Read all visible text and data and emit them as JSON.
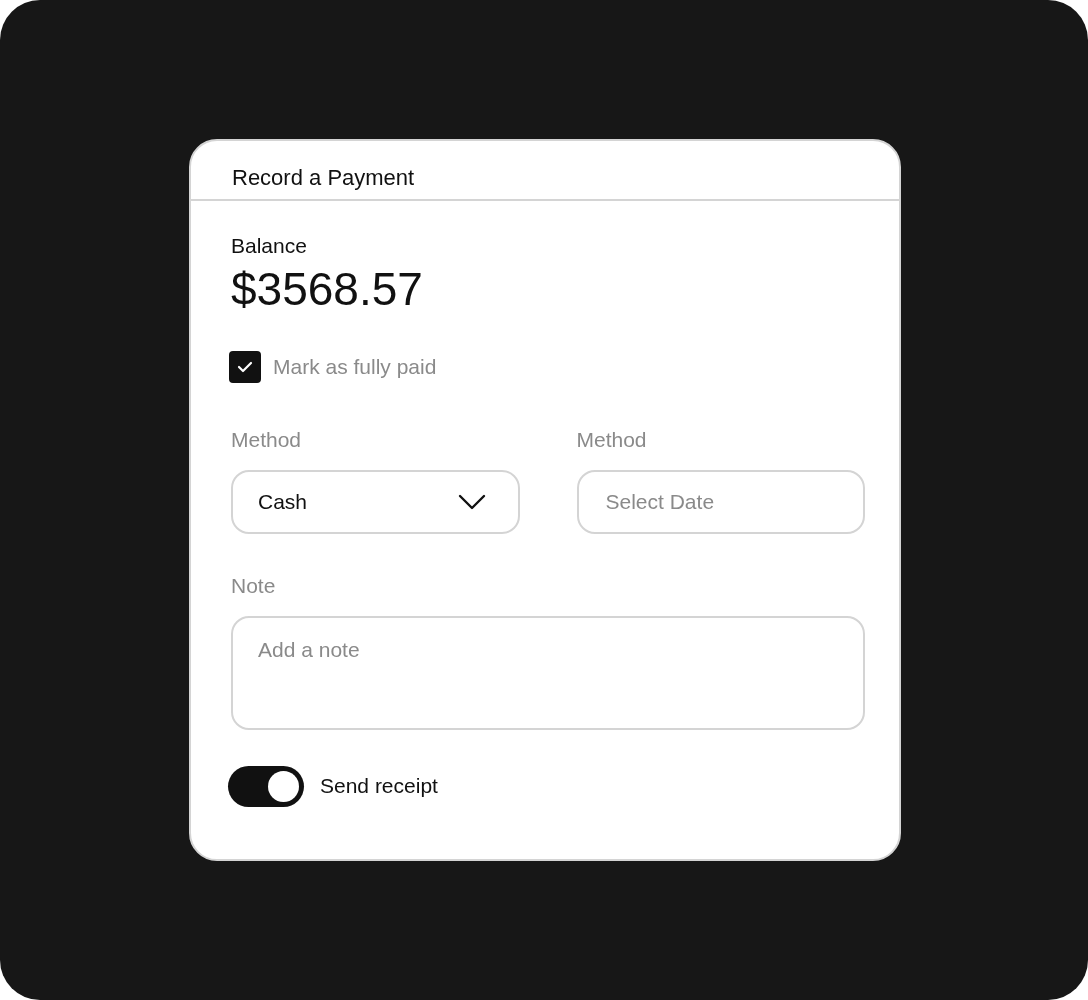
{
  "dialog": {
    "title": "Record a Payment"
  },
  "balance": {
    "label": "Balance",
    "amount": "$3568.57"
  },
  "fully_paid": {
    "label": "Mark as fully paid",
    "checked": true
  },
  "fields": [
    {
      "kind": "select",
      "label": "Method",
      "value": "Cash"
    },
    {
      "kind": "input",
      "label": "Method",
      "placeholder": "Select Date"
    }
  ],
  "note": {
    "label": "Note",
    "placeholder": "Add a note"
  },
  "receipt": {
    "label": "Send receipt",
    "on": true
  }
}
